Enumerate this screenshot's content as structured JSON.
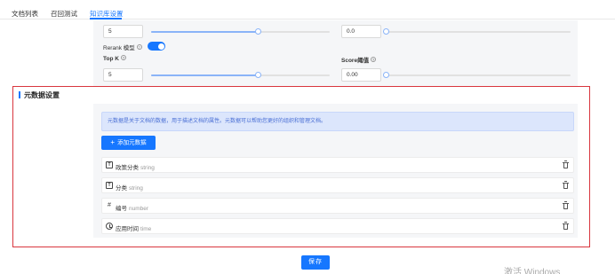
{
  "tabs": [
    {
      "label": "文档列表"
    },
    {
      "label": "召回测试"
    },
    {
      "label": "知识库设置",
      "active": true
    }
  ],
  "settings": {
    "row1": {
      "left_value": "5",
      "left_level": 0.6,
      "right_value": "0.0",
      "right_level": 0.0
    },
    "rerank": {
      "label": "Rerank 模型",
      "enabled": true
    },
    "topk": {
      "label": "Top K",
      "value": "5",
      "level": 0.6
    },
    "score": {
      "label": "Score阈值",
      "value": "0.00",
      "level": 0.0
    }
  },
  "metadata": {
    "title": "元数据设置",
    "description": "元数据是关于文档的数据，用于描述文档的属性。元数据可以帮助您更好的组织和管理文档。",
    "add_label": "添加元数据",
    "items": [
      {
        "icon": "text-type-icon",
        "name": "政策分类",
        "type": "string"
      },
      {
        "icon": "text-type-icon",
        "name": "分类",
        "type": "string"
      },
      {
        "icon": "number-type-icon",
        "name": "编号",
        "type": "number"
      },
      {
        "icon": "time-type-icon",
        "name": "应用时间",
        "type": "time"
      }
    ]
  },
  "save_label": "保存",
  "watermark": "激活 Windows",
  "colors": {
    "accent": "#1677ff",
    "highlight_border": "#d9363e",
    "alert_bg": "#dce6fc"
  }
}
